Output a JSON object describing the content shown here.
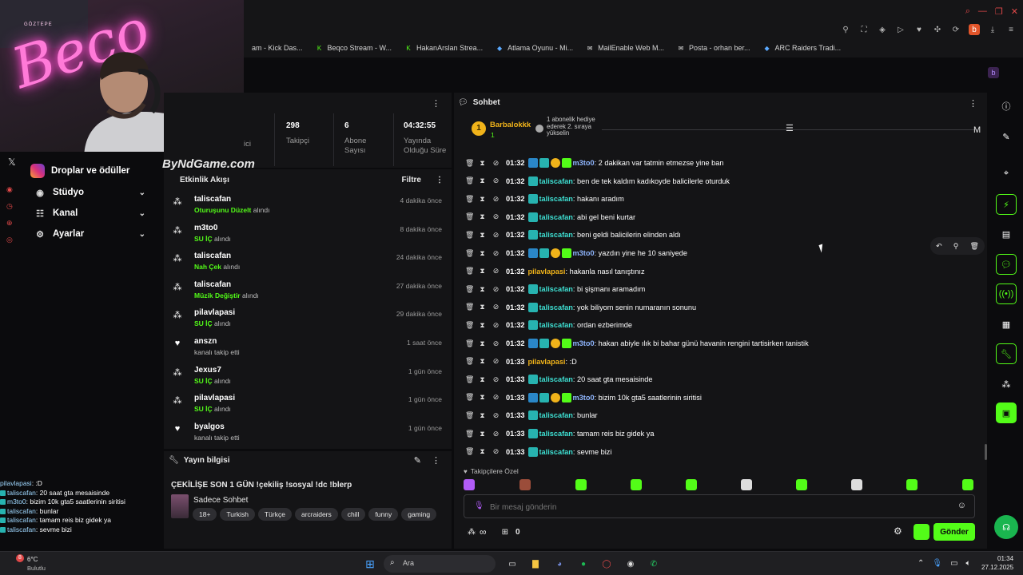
{
  "browser": {
    "bookmarks": [
      {
        "icon": "kick-icon",
        "label": "am - Kick Das..."
      },
      {
        "icon": "kick-icon",
        "label": "Beqco Stream - W..."
      },
      {
        "icon": "kick-icon",
        "label": "HakanArslan Strea..."
      },
      {
        "icon": "game-icon",
        "label": "Atlama Oyunu - Mi..."
      },
      {
        "icon": "mail-icon",
        "label": "MailEnable Web M..."
      },
      {
        "icon": "mail-icon",
        "label": "Posta - orhan ber..."
      },
      {
        "icon": "game-icon",
        "label": "ARC Raiders Tradi..."
      }
    ]
  },
  "webcam": {
    "neon_text": "Beco",
    "sign_text": "GÖZTEPE",
    "watermark": "ByNdGame.com"
  },
  "nav": {
    "drops_label": "Droplar ve ödüller",
    "items": [
      {
        "icon": "studio-icon",
        "label": "Stüdyo"
      },
      {
        "icon": "channel-icon",
        "label": "Kanal"
      },
      {
        "icon": "gear-icon",
        "label": "Ayarlar"
      }
    ]
  },
  "overlay_chat": [
    {
      "user": "pilavlapasi",
      "text": ":D"
    },
    {
      "user": "taliscafan",
      "text": "20 saat gta mesaisinde"
    },
    {
      "user": "m3to0",
      "text": "bizim 10k gta5 saatlerinin siritisi"
    },
    {
      "user": "taliscafan",
      "text": "bunlar"
    },
    {
      "user": "taliscafan",
      "text": "tamam reis biz gidek ya"
    },
    {
      "user": "taliscafan",
      "text": "sevme bizi"
    }
  ],
  "stats": {
    "partial_label": "ici",
    "items": [
      {
        "value": "298",
        "label": "Takipçi"
      },
      {
        "value": "6",
        "label": "Abone Sayısı"
      },
      {
        "value": "04:32:55",
        "label": "Yayında Olduğu Süre"
      }
    ]
  },
  "activity": {
    "title": "Etkinlik Akışı",
    "filter_label": "Filtre",
    "items": [
      {
        "icon": "drops-icon",
        "name": "taliscafan",
        "reward": "Oturuşunu Düzelt",
        "suffix": "alındı",
        "time": "4 dakika önce"
      },
      {
        "icon": "drops-icon",
        "name": "m3to0",
        "reward": "SU İÇ",
        "suffix": "alındı",
        "time": "8 dakika önce"
      },
      {
        "icon": "drops-icon",
        "name": "taliscafan",
        "reward": "Nah Çek",
        "suffix": "alındı",
        "time": "24 dakika önce"
      },
      {
        "icon": "drops-icon",
        "name": "taliscafan",
        "reward": "Müzik Değiştir",
        "suffix": "alındı",
        "time": "27 dakika önce"
      },
      {
        "icon": "drops-icon",
        "name": "pilavlapasi",
        "reward": "SU İÇ",
        "suffix": "alındı",
        "time": "29 dakika önce"
      },
      {
        "icon": "heart-icon",
        "name": "anszn",
        "reward": "",
        "suffix": "kanalı takip etti",
        "time": "1 saat önce"
      },
      {
        "icon": "drops-icon",
        "name": "Jexus7",
        "reward": "SU İÇ",
        "suffix": "alındı",
        "time": "1 gün önce"
      },
      {
        "icon": "drops-icon",
        "name": "pilavlapasi",
        "reward": "SU İÇ",
        "suffix": "alındı",
        "time": "1 gün önce"
      },
      {
        "icon": "heart-icon",
        "name": "byalgos",
        "reward": "",
        "suffix": "kanalı takip etti",
        "time": "1 gün önce"
      }
    ]
  },
  "stream_info": {
    "title": "Yayın bilgisi",
    "stream_title": "ÇEKİLİŞE SON 1 GÜN !çekiliş !sosyal !dc !blerp",
    "category": "Sadece Sohbet",
    "tags": [
      "18+",
      "Turkish",
      "Türkçe",
      "arcraiders",
      "chill",
      "funny",
      "gaming"
    ]
  },
  "chat": {
    "title": "Sohbet",
    "pinned": {
      "rank": "1",
      "user": "Barbalokkk",
      "count": "1",
      "note": "1 abonelik hediye ederek 2. sıraya yükselin"
    },
    "messages": [
      {
        "time": "01:32",
        "badges": [
          "blue",
          "teal",
          "gold",
          "green"
        ],
        "user": "m3to0",
        "ucls": "user-purple",
        "text": "2 dakikan var tatmin etmezse yine ban"
      },
      {
        "time": "01:32",
        "badges": [
          "teal"
        ],
        "user": "taliscafan",
        "ucls": "user-teal",
        "text": "ben de tek kaldım kadıkoyde balicilerle oturduk"
      },
      {
        "time": "01:32",
        "badges": [
          "teal"
        ],
        "user": "taliscafan",
        "ucls": "user-teal",
        "text": "hakanı aradım"
      },
      {
        "time": "01:32",
        "badges": [
          "teal"
        ],
        "user": "taliscafan",
        "ucls": "user-teal",
        "text": "abi gel beni kurtar"
      },
      {
        "time": "01:32",
        "badges": [
          "teal"
        ],
        "user": "taliscafan",
        "ucls": "user-teal",
        "text": "beni geldi balicilerin elinden aldı"
      },
      {
        "time": "01:32",
        "badges": [
          "blue",
          "teal",
          "gold",
          "green"
        ],
        "user": "m3to0",
        "ucls": "user-purple",
        "text": "yazdın yine he 10 saniyede"
      },
      {
        "time": "01:32",
        "badges": [],
        "user": "pilavlapasi",
        "ucls": "user-gold",
        "text": "hakanla nasıl tanıştınız"
      },
      {
        "time": "01:32",
        "badges": [
          "teal"
        ],
        "user": "taliscafan",
        "ucls": "user-teal",
        "text": "bi şişmanı aramadım"
      },
      {
        "time": "01:32",
        "badges": [
          "teal"
        ],
        "user": "taliscafan",
        "ucls": "user-teal",
        "text": "yok biliyom senin numaranın sonunu"
      },
      {
        "time": "01:32",
        "badges": [
          "teal"
        ],
        "user": "taliscafan",
        "ucls": "user-teal",
        "text": "ordan ezberimde"
      },
      {
        "time": "01:32",
        "badges": [
          "blue",
          "teal",
          "gold",
          "green"
        ],
        "user": "m3to0",
        "ucls": "user-purple",
        "text": "hakan abiyle ılık bi bahar günü havanin rengini tartisirken tanistik"
      },
      {
        "time": "01:33",
        "badges": [],
        "user": "pilavlapasi",
        "ucls": "user-gold",
        "text": ":D"
      },
      {
        "time": "01:33",
        "badges": [
          "teal"
        ],
        "user": "taliscafan",
        "ucls": "user-teal",
        "text": "20 saat gta mesaisinde"
      },
      {
        "time": "01:33",
        "badges": [
          "blue",
          "teal",
          "gold",
          "green"
        ],
        "user": "m3to0",
        "ucls": "user-purple",
        "text": "bizim 10k gta5 saatlerinin siritisi"
      },
      {
        "time": "01:33",
        "badges": [
          "teal"
        ],
        "user": "taliscafan",
        "ucls": "user-teal",
        "text": "bunlar"
      },
      {
        "time": "01:33",
        "badges": [
          "teal"
        ],
        "user": "taliscafan",
        "ucls": "user-teal",
        "text": "tamam reis biz gidek ya"
      },
      {
        "time": "01:33",
        "badges": [
          "teal"
        ],
        "user": "taliscafan",
        "ucls": "user-teal",
        "text": "sevme bizi"
      }
    ],
    "emote_section": "Takipçilere Özel",
    "input_placeholder": "Bir mesaj gönderin",
    "points": "0",
    "send_label": "Gönder",
    "right_letter": "M"
  },
  "taskbar": {
    "weather_temp": "6°C",
    "weather_desc": "Bulutlu",
    "search_placeholder": "Ara",
    "time": "01:34",
    "date": "27.12.2025",
    "notif_count": "8"
  },
  "colors": {
    "kick_green": "#53fc18",
    "panel": "#141416",
    "bg": "#0b0b0d"
  }
}
